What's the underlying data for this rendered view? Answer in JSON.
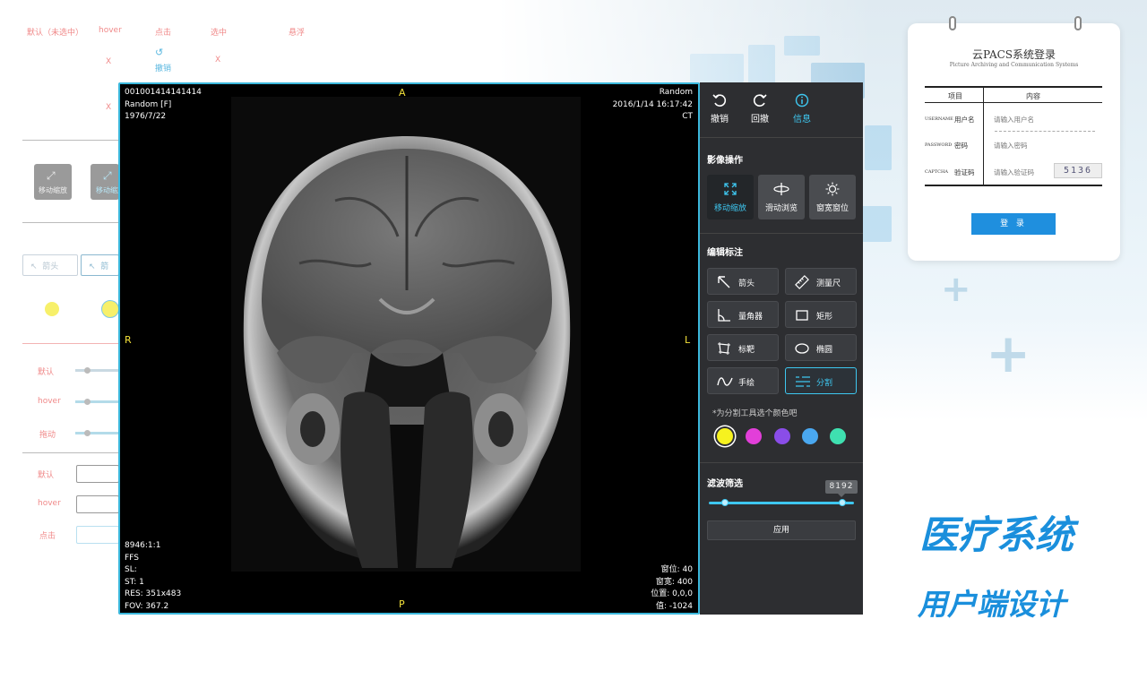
{
  "spec": {
    "states": [
      "默认（未选中）",
      "hover",
      "点击",
      "选中",
      "悬浮"
    ],
    "undo_mark": "撤销",
    "x_mark": "X",
    "gray_btn_1": "移动缩放",
    "gray_btn_2": "移动缩放",
    "outline_btn_1": "箭头",
    "outline_btn_2": "箭",
    "slider_states": [
      "默认",
      "hover",
      "拖动"
    ],
    "input_states": [
      "默认",
      "hover",
      "点击"
    ]
  },
  "viewer": {
    "top_left": [
      "001001414141414",
      "Random [F]",
      "1976/7/22"
    ],
    "top_right": [
      "Random",
      "2016/1/14 16:17:42",
      "CT"
    ],
    "bottom_left": [
      "8946:1:1",
      "FFS",
      "SL:",
      "ST: 1",
      "RES: 351x483",
      "FOV: 367.2"
    ],
    "bottom_right": [
      "窗位: 40",
      "窗宽: 400",
      "位置: 0,0,0",
      "值: -1024"
    ],
    "orient": {
      "top": "A",
      "bottom": "P",
      "left": "R",
      "right": "L"
    }
  },
  "panel": {
    "top_tools": [
      {
        "label": "撤销",
        "icon": "undo-icon"
      },
      {
        "label": "回撤",
        "icon": "redo-icon"
      },
      {
        "label": "信息",
        "icon": "info-icon"
      }
    ],
    "image_ops_title": "影像操作",
    "image_ops": [
      {
        "label": "移动缩放",
        "icon": "move-zoom-icon"
      },
      {
        "label": "滑动浏览",
        "icon": "scroll-browse-icon"
      },
      {
        "label": "窗宽窗位",
        "icon": "window-level-icon"
      }
    ],
    "annot_title": "编辑标注",
    "annot_tools": [
      {
        "label": "箭头",
        "icon": "arrow-icon"
      },
      {
        "label": "测量尺",
        "icon": "ruler-icon"
      },
      {
        "label": "量角器",
        "icon": "angle-icon"
      },
      {
        "label": "矩形",
        "icon": "rectangle-icon"
      },
      {
        "label": "标靶",
        "icon": "target-icon"
      },
      {
        "label": "椭圆",
        "icon": "ellipse-icon"
      },
      {
        "label": "手绘",
        "icon": "freehand-icon"
      },
      {
        "label": "分割",
        "icon": "segment-icon"
      }
    ],
    "hint": "*为分割工具选个颜色吧",
    "colors": [
      "#f6f21f",
      "#e23fd9",
      "#8a4de8",
      "#4aa8f0",
      "#3fe0b0"
    ],
    "filter_title": "滤波筛选",
    "filter_value": "8192",
    "filter_fraction": 0.0,
    "apply_label": "应用"
  },
  "login": {
    "title": "云PACS系统登录",
    "subtitle": "Picture Archiving and Communication Systems",
    "col_item": "项目",
    "col_content": "内容",
    "rows": [
      {
        "en": "USERNAME",
        "cn": "用户名",
        "ph": "请输入用户名"
      },
      {
        "en": "PASSWORD",
        "cn": "密码",
        "ph": "请输入密码"
      },
      {
        "en": "CAPTCHA",
        "cn": "验证码",
        "ph": "请输入验证码"
      }
    ],
    "captcha": "5136",
    "button": "登 录"
  },
  "hero": {
    "line1": "医疗系统",
    "line2": "用户端设计"
  },
  "colors": {
    "accent": "#3ec7f0",
    "panel_bg": "#2d2e31",
    "orient": "#f3e03a",
    "brand_blue": "#1a8fdc"
  }
}
